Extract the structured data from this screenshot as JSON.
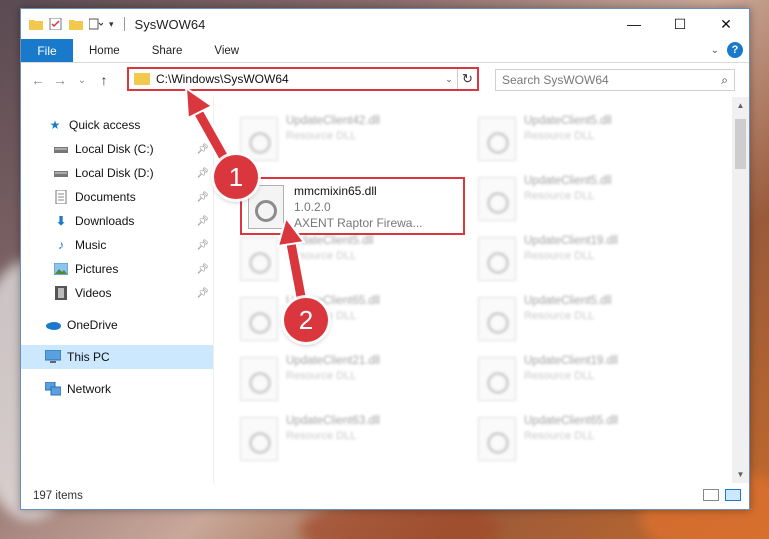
{
  "window": {
    "title": "SysWOW64",
    "controls": {
      "minimize": "—",
      "maximize": "☐",
      "close": "✕"
    }
  },
  "ribbon": {
    "file_tab": "File",
    "tabs": [
      "Home",
      "Share",
      "View"
    ]
  },
  "navigation": {
    "back": "←",
    "forward": "→",
    "recent": "⌄",
    "up": "↑",
    "address_path": "C:\\Windows\\SysWOW64",
    "search_placeholder": "Search SysWOW64"
  },
  "sidebar": {
    "items": [
      {
        "label": "Quick access",
        "icon": "star-icon",
        "pinned": false
      },
      {
        "label": "Local Disk (C:)",
        "icon": "drive-icon",
        "pinned": true
      },
      {
        "label": "Local Disk (D:)",
        "icon": "drive-icon",
        "pinned": true
      },
      {
        "label": "Documents",
        "icon": "documents-icon",
        "pinned": true
      },
      {
        "label": "Downloads",
        "icon": "download-icon",
        "pinned": true
      },
      {
        "label": "Music",
        "icon": "music-icon",
        "pinned": true
      },
      {
        "label": "Pictures",
        "icon": "pictures-icon",
        "pinned": true
      },
      {
        "label": "Videos",
        "icon": "videos-icon",
        "pinned": true
      },
      {
        "label": "OneDrive",
        "icon": "cloud-icon",
        "pinned": false
      },
      {
        "label": "This PC",
        "icon": "computer-icon",
        "pinned": false,
        "selected": true
      },
      {
        "label": "Network",
        "icon": "network-icon",
        "pinned": false
      }
    ]
  },
  "files": {
    "highlighted": {
      "name": "mmcmixin65.dll",
      "version": "1.0.2.0",
      "description": "AXENT Raptor Firewa..."
    },
    "left_column": [
      {
        "name": "UpdateClient42.dll",
        "type": "Resource DLL"
      },
      {
        "name": "UpdateClient5.dll",
        "type": "Resource DLL"
      },
      {
        "name": "UpdateClient65.dll",
        "type": "Resource DLL"
      },
      {
        "name": "UpdateClient21.dll",
        "type": "Resource DLL"
      },
      {
        "name": "UpdateClient63.dll",
        "type": "Resource DLL"
      }
    ],
    "right_column": [
      {
        "name": "UpdateClient5.dll",
        "type": "Resource DLL"
      },
      {
        "name": "UpdateClient5.dll",
        "type": "Resource DLL"
      },
      {
        "name": "UpdateClient19.dll",
        "type": "Resource DLL"
      },
      {
        "name": "UpdateClient5.dll",
        "type": "Resource DLL"
      },
      {
        "name": "UpdateClient19.dll",
        "type": "Resource DLL"
      },
      {
        "name": "UpdateClient65.dll",
        "type": "Resource DLL"
      }
    ]
  },
  "status": {
    "item_count": "197 items"
  },
  "annotations": {
    "step1": "1",
    "step2": "2",
    "color": "#d9363e"
  }
}
